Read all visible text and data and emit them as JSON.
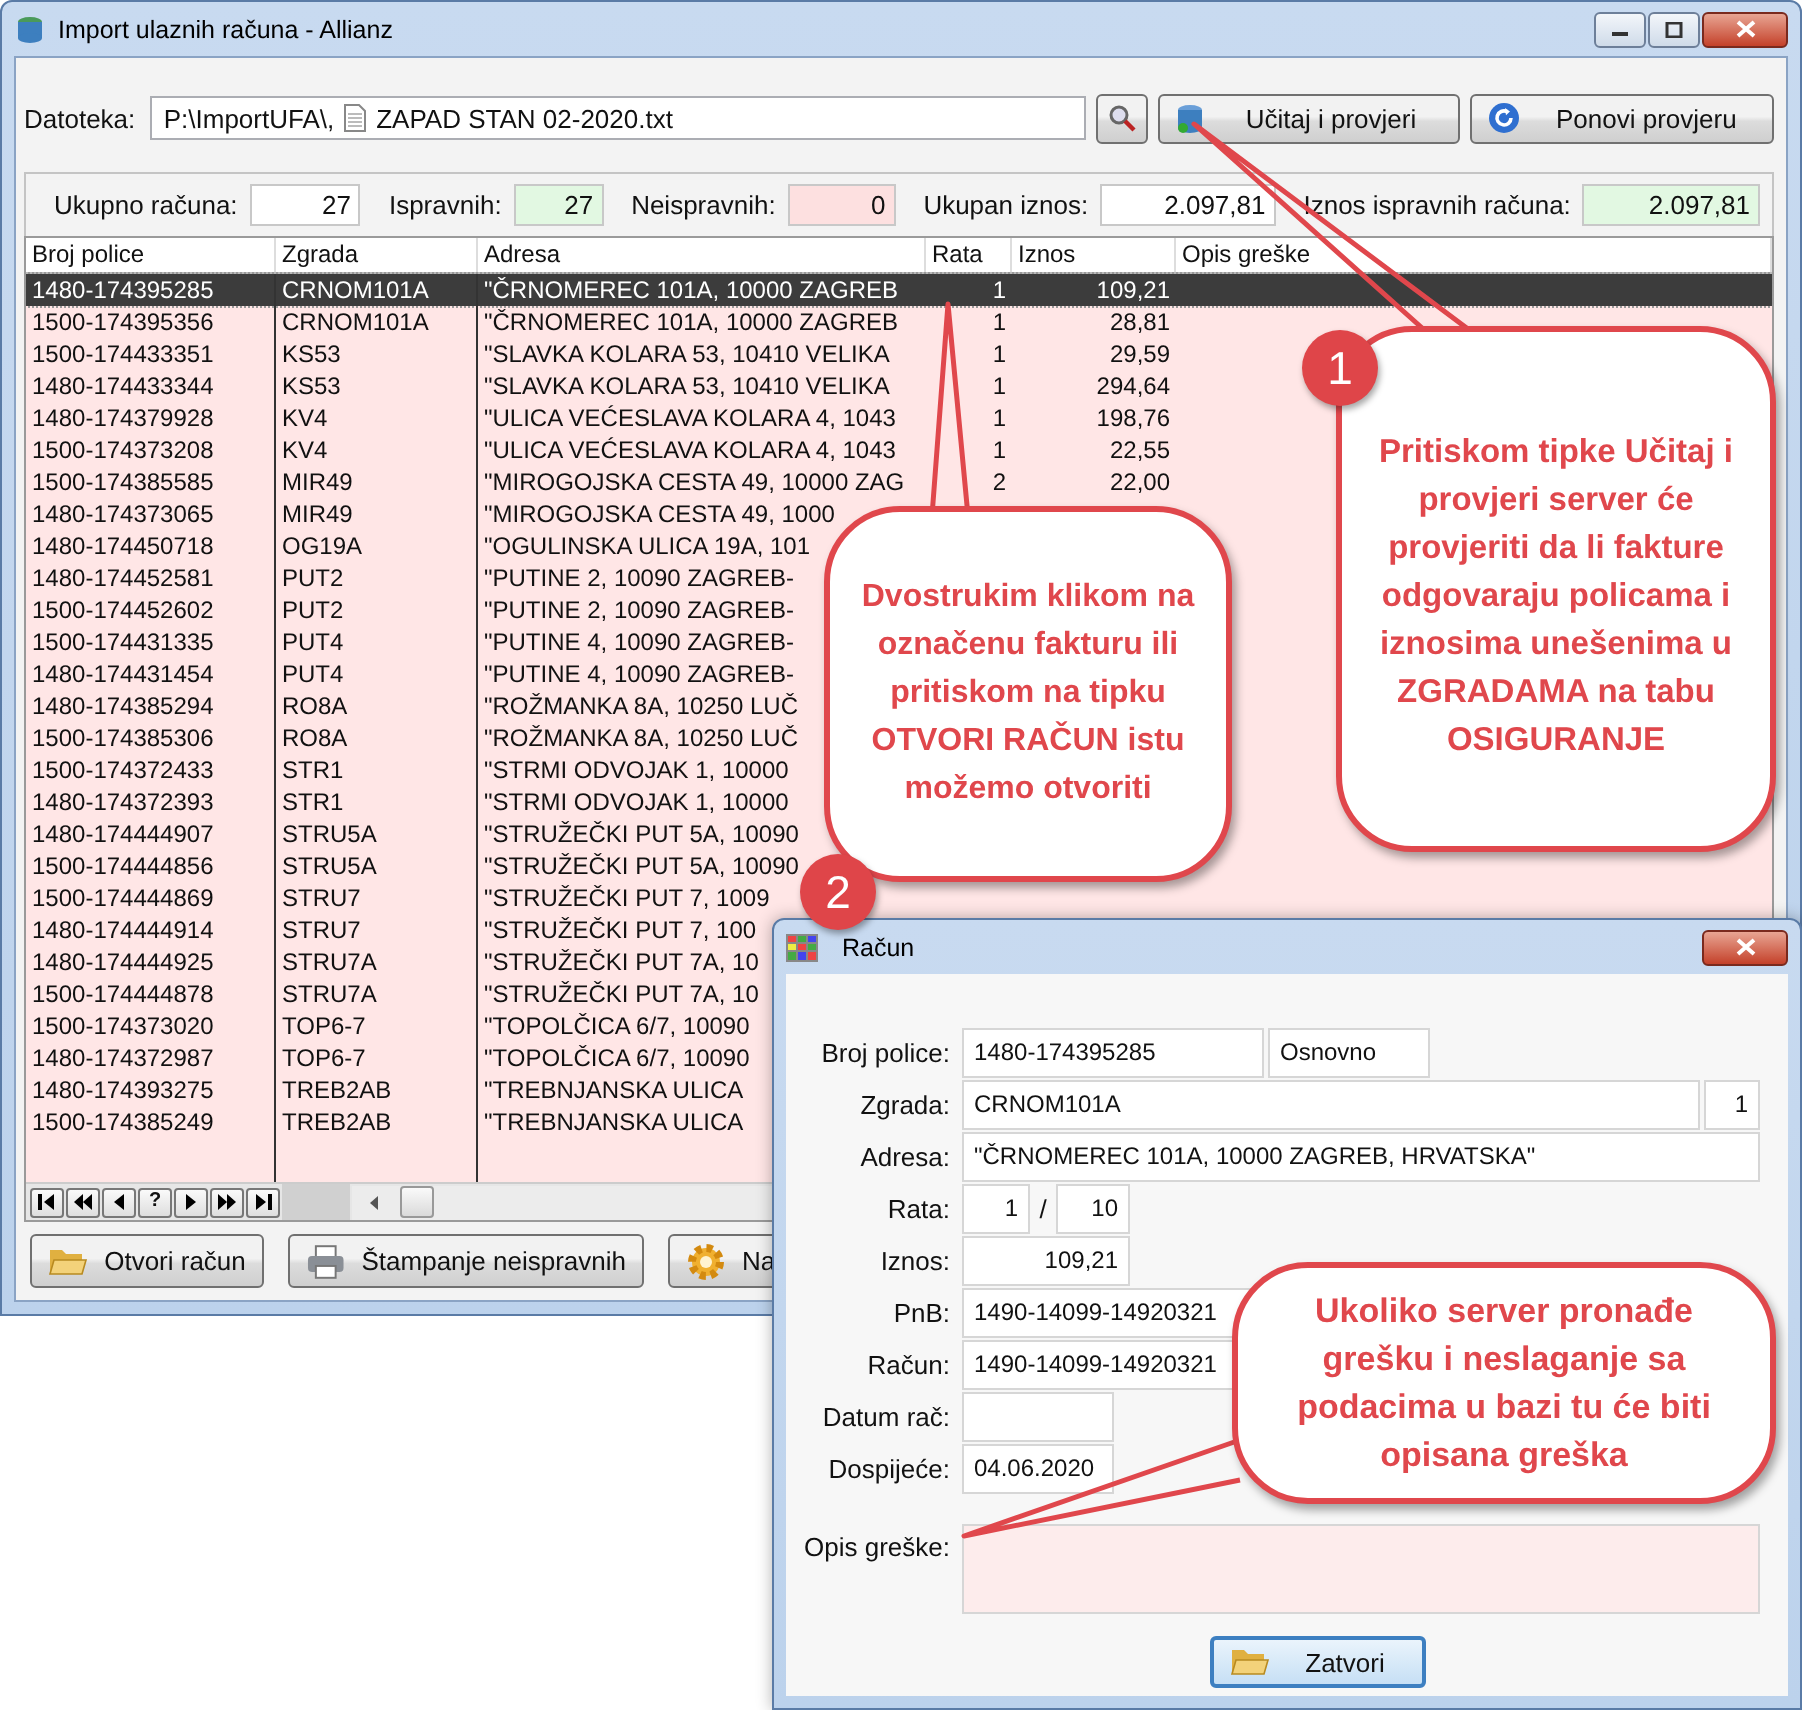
{
  "window": {
    "title": "Import ulaznih računa - Allianz"
  },
  "file_row": {
    "label": "Datoteka:",
    "path": "P:\\ImportUFA\\,",
    "file": "ZAPAD STAN 02-2020.txt",
    "buttons": [
      "Učitaj i provjeri",
      "Ponovi provjeru"
    ]
  },
  "summary": [
    {
      "label": "Ukupno računa:",
      "value": "27",
      "color": "#ffffff"
    },
    {
      "label": "Ispravnih:",
      "value": "27",
      "color": "#e2f8e2"
    },
    {
      "label": "Neispravnih:",
      "value": "0",
      "color": "#fde0e0"
    },
    {
      "label": "Ukupan iznos:",
      "value": "2.097,81",
      "color": "#ffffff"
    },
    {
      "label": "Iznos ispravnih računa:",
      "value": "2.097,81",
      "color": "#e2f8e2"
    }
  ],
  "table": {
    "columns": [
      "Broj police",
      "Zgrada",
      "Adresa",
      "Rata",
      "Iznos",
      "Opis greške"
    ],
    "rows": [
      {
        "cells": [
          "1480-174395285",
          "CRNOM101A",
          "\"ČRNOMEREC 101A, 10000 ZAGREB",
          "1",
          "109,21"
        ],
        "selected": true
      },
      {
        "cells": [
          "1500-174395356",
          "CRNOM101A",
          "\"ČRNOMEREC 101A, 10000 ZAGREB",
          "1",
          "28,81"
        ],
        "selected": false
      },
      {
        "cells": [
          "1500-174433351",
          "KS53",
          "\"SLAVKA KOLARA 53, 10410 VELIKA",
          "1",
          "29,59"
        ],
        "selected": false
      },
      {
        "cells": [
          "1480-174433344",
          "KS53",
          "\"SLAVKA KOLARA 53, 10410 VELIKA",
          "1",
          "294,64"
        ],
        "selected": false
      },
      {
        "cells": [
          "1480-174379928",
          "KV4",
          "\"ULICA VEĆESLAVA KOLARA 4, 1043",
          "1",
          "198,76"
        ],
        "selected": false
      },
      {
        "cells": [
          "1500-174373208",
          "KV4",
          "\"ULICA VEĆESLAVA KOLARA 4, 1043",
          "1",
          "22,55"
        ],
        "selected": false
      },
      {
        "cells": [
          "1500-174385585",
          "MIR49",
          "\"MIROGOJSKA CESTA 49, 10000 ZAG",
          "2",
          "22,00"
        ],
        "selected": false
      },
      {
        "cells": [
          "1480-174373065",
          "MIR49",
          "\"MIROGOJSKA CESTA 49, 1000"
        ],
        "selected": false
      },
      {
        "cells": [
          "1480-174450718",
          "OG19A",
          "\"OGULINSKA ULICA 19A, 101"
        ],
        "selected": false
      },
      {
        "cells": [
          "1480-174452581",
          "PUT2",
          "\"PUTINE 2, 10090 ZAGREB-"
        ],
        "selected": false
      },
      {
        "cells": [
          "1500-174452602",
          "PUT2",
          "\"PUTINE 2, 10090 ZAGREB-"
        ],
        "selected": false
      },
      {
        "cells": [
          "1500-174431335",
          "PUT4",
          "\"PUTINE 4, 10090 ZAGREB-"
        ],
        "selected": false
      },
      {
        "cells": [
          "1480-174431454",
          "PUT4",
          "\"PUTINE 4, 10090 ZAGREB-"
        ],
        "selected": false
      },
      {
        "cells": [
          "1480-174385294",
          "RO8A",
          "\"ROŽMANKA 8A, 10250 LUČ"
        ],
        "selected": false
      },
      {
        "cells": [
          "1500-174385306",
          "RO8A",
          "\"ROŽMANKA 8A, 10250 LUČ"
        ],
        "selected": false
      },
      {
        "cells": [
          "1500-174372433",
          "STR1",
          "\"STRMI ODVOJAK 1, 10000"
        ],
        "selected": false
      },
      {
        "cells": [
          "1480-174372393",
          "STR1",
          "\"STRMI ODVOJAK 1, 10000"
        ],
        "selected": false
      },
      {
        "cells": [
          "1480-174444907",
          "STRU5A",
          "\"STRUŽEČKI PUT 5A, 10090"
        ],
        "selected": false
      },
      {
        "cells": [
          "1500-174444856",
          "STRU5A",
          "\"STRUŽEČKI PUT 5A, 10090"
        ],
        "selected": false
      },
      {
        "cells": [
          "1500-174444869",
          "STRU7",
          "\"STRUŽEČKI PUT 7, 1009"
        ],
        "selected": false
      },
      {
        "cells": [
          "1480-174444914",
          "STRU7",
          "\"STRUŽEČKI PUT 7, 100"
        ],
        "selected": false
      },
      {
        "cells": [
          "1480-174444925",
          "STRU7A",
          "\"STRUŽEČKI PUT 7A, 10"
        ],
        "selected": false
      },
      {
        "cells": [
          "1500-174444878",
          "STRU7A",
          "\"STRUŽEČKI PUT 7A, 10"
        ],
        "selected": false
      },
      {
        "cells": [
          "1500-174373020",
          "TOP6-7",
          "\"TOPOLČICA 6/7, 10090"
        ],
        "selected": false
      },
      {
        "cells": [
          "1480-174372987",
          "TOP6-7",
          "\"TOPOLČICA 6/7, 10090"
        ],
        "selected": false
      },
      {
        "cells": [
          "1480-174393275",
          "TREB2AB",
          "\"TREBNJANSKA ULICA"
        ],
        "selected": false
      },
      {
        "cells": [
          "1500-174385249",
          "TREB2AB",
          "\"TREBNJANSKA ULICA"
        ],
        "selected": false
      }
    ]
  },
  "navigator": {
    "help": "?"
  },
  "actions": [
    "Otvori račun",
    "Štampanje neispravnih",
    "Na"
  ],
  "dialog": {
    "title": "Račun",
    "fields": [
      {
        "label": "Broj police:",
        "values": [
          "1480-174395285",
          "Osnovno"
        ]
      },
      {
        "label": "Zgrada:",
        "values": [
          "CRNOM101A",
          "1"
        ]
      },
      {
        "label": "Adresa:",
        "values": [
          "\"ČRNOMEREC 101A, 10000 ZAGREB, HRVATSKA\""
        ]
      },
      {
        "label": "Rata:",
        "values": [
          "1",
          "10"
        ],
        "separator": "/"
      },
      {
        "label": "Iznos:",
        "values": [
          "109,21"
        ]
      },
      {
        "label": "PnB:",
        "values": [
          "1490-14099-14920321"
        ]
      },
      {
        "label": "Račun:",
        "values": [
          "1490-14099-14920321"
        ]
      },
      {
        "label": "Datum rač:"
      },
      {
        "label": "Dospijeće:",
        "values": [
          "04.06.2020"
        ]
      }
    ],
    "error_field": {
      "label": "Opis greške:"
    },
    "close_button": "Zatvori"
  },
  "callouts": [
    {
      "badge": "1",
      "text": "Pritiskom tipke Učitaj i provjeri server će provjeriti da li fakture odgovaraju policama i iznosima unešenima u ZGRADAMA na tabu OSIGURANJE"
    },
    {
      "badge": "2",
      "text": "Dvostrukim klikom na označenu fakturu ili pritiskom na tipku OTVORI RAČUN istu možemo otvoriti"
    },
    {
      "text": "Ukoliko server pronađe grešku i neslaganje sa podacima u bazi tu će biti opisana greška"
    }
  ]
}
